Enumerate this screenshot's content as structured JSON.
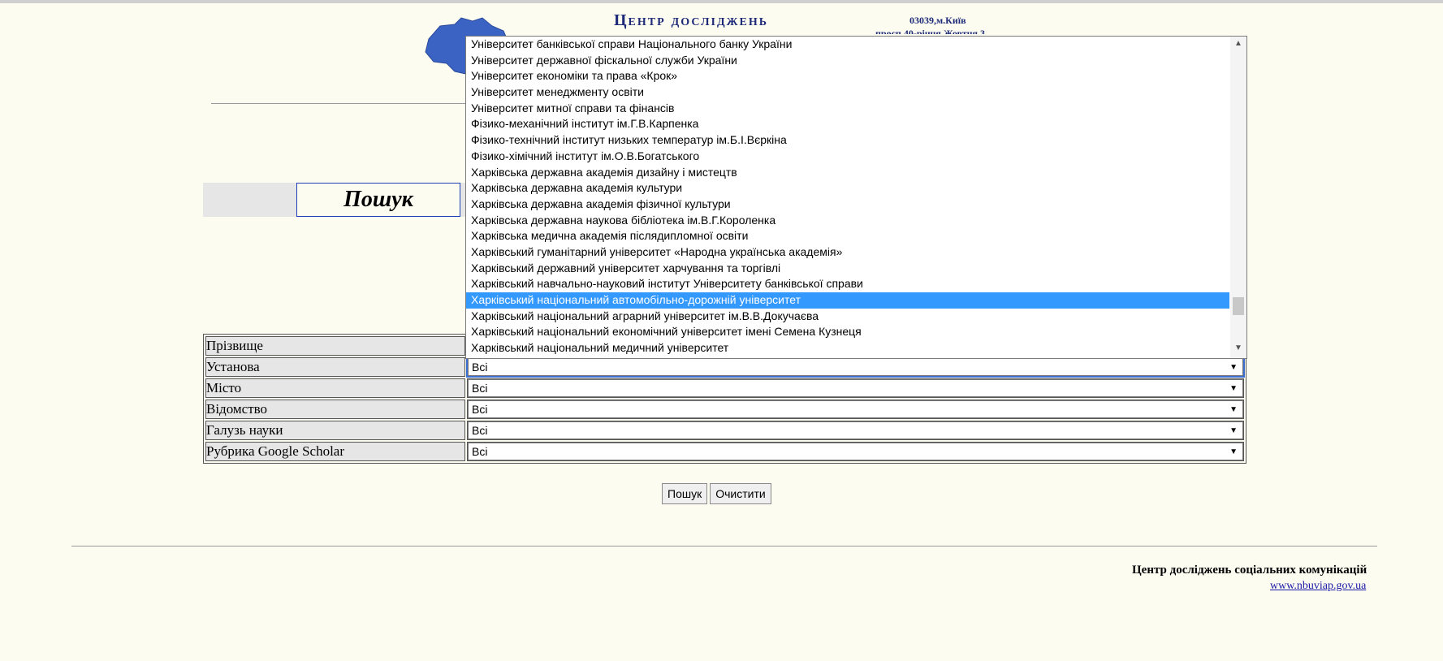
{
  "header": {
    "title": "Центр досліджень",
    "address_line1": "03039,м.Київ",
    "address_line2": "просп.40-річчя Жовтня,3"
  },
  "search_heading": "Пошук",
  "form": {
    "fields": [
      {
        "label": "Прізвище",
        "value": ""
      },
      {
        "label": "Установа",
        "value": "Всі"
      },
      {
        "label": "Місто",
        "value": "Всі"
      },
      {
        "label": "Відомство",
        "value": "Всі"
      },
      {
        "label": "Галузь науки",
        "value": "Всі"
      },
      {
        "label": "Рубрика Google Scholar",
        "value": "Всі"
      }
    ]
  },
  "dropdown": {
    "options": [
      "Університет банківської справи Національного банку України",
      "Університет державної фіскальної служби України",
      "Університет економіки та права «Крок»",
      "Університет менеджменту освіти",
      "Університет митної справи та фінансів",
      "Фізико-механічний інститут ім.Г.В.Карпенка",
      "Фізико-технічний інститут низьких температур ім.Б.І.Вєркіна",
      "Фізико-хімічний інститут ім.О.В.Богатського",
      "Харківська державна академія дизайну і мистецтв",
      "Харківська державна академія культури",
      "Харківська державна академія фізичної культури",
      "Харківська державна наукова бібліотека ім.В.Г.Короленка",
      "Харківська медична академія післядипломної освіти",
      "Харківський гуманітарний університет «Народна українська академія»",
      "Харківський державний університет харчування та торгівлі",
      "Харківський навчально-науковий інститут Університету банківської справи",
      "Харківський національний автомобільно-дорожній університет",
      "Харківський національний аграрний університет ім.В.В.Докучаєва",
      "Харківський національний економічний університет імені Семена Кузнеця",
      "Харківський національний медичний університет"
    ],
    "selected_index": 16
  },
  "buttons": {
    "search": "Пошук",
    "clear": "Очистити"
  },
  "footer": {
    "name": "Центр досліджень соціальних комунікацій",
    "link": "www.nbuviap.gov.ua"
  },
  "colors": {
    "background": "#fdfcf0",
    "accent": "#1c2a78",
    "selection": "#3399ff",
    "map": "#3a63c4"
  }
}
